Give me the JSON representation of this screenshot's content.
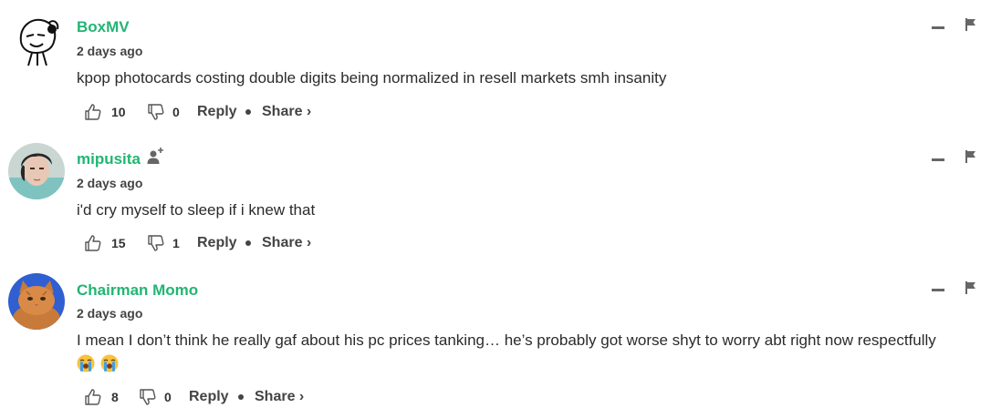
{
  "comments": [
    {
      "username": "BoxMV",
      "timestamp": "2 days ago",
      "text": "kpop photocards costing double digits being normalized in resell markets smh insanity",
      "likes": "10",
      "dislikes": "0",
      "reply_label": "Reply",
      "share_label": "Share ›",
      "avatar": "cartoon-face-with-headphones",
      "has_follow_icon": false,
      "emojis": []
    },
    {
      "username": "mipusita",
      "timestamp": "2 days ago",
      "text": "i'd cry myself to sleep if i knew that",
      "likes": "15",
      "dislikes": "1",
      "reply_label": "Reply",
      "share_label": "Share ›",
      "avatar": "person-photo",
      "has_follow_icon": true,
      "emojis": []
    },
    {
      "username": "Chairman Momo",
      "timestamp": "2 days ago",
      "text": "I mean I don’t think he really gaf about his pc prices tanking… he’s probably got worse shyt to worry abt right now respectfully",
      "likes": "8",
      "dislikes": "0",
      "reply_label": "Reply",
      "share_label": "Share ›",
      "avatar": "orange-cat-photo",
      "has_follow_icon": false,
      "emojis": [
        "loudly-crying-face",
        "loudly-crying-face"
      ]
    }
  ],
  "colors": {
    "username": "#22b573",
    "text": "#2b2b2b",
    "meta": "#444444"
  }
}
